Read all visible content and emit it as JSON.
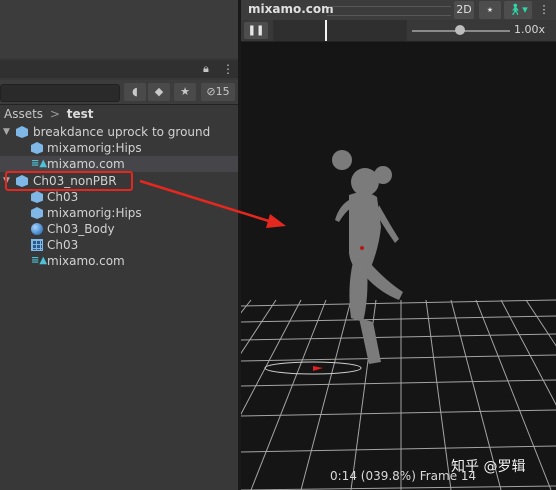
{
  "project": {
    "hidden_count": "15",
    "breadcrumb": {
      "root": "Assets",
      "separator": ">",
      "current": "test"
    }
  },
  "tree": [
    {
      "label": "breakdance uprock to ground",
      "type": "model",
      "expanded": true
    },
    {
      "label": "mixamorig:Hips",
      "type": "model",
      "expanded": false
    },
    {
      "label": "mixamo.com",
      "type": "animation",
      "expanded": false
    },
    {
      "label": "Ch03_nonPBR",
      "type": "model",
      "expanded": true
    },
    {
      "label": "Ch03",
      "type": "model",
      "expanded": false
    },
    {
      "label": "mixamorig:Hips",
      "type": "model",
      "expanded": false
    },
    {
      "label": "Ch03_Body",
      "type": "material",
      "expanded": false
    },
    {
      "label": "Ch03",
      "type": "mesh",
      "expanded": false
    },
    {
      "label": "mixamo.com",
      "type": "animation",
      "expanded": false
    }
  ],
  "preview": {
    "title": "mixamo.com",
    "btn_2d": "2D",
    "speed": "1.00x",
    "playhead_fraction": 0.39,
    "status": "0:14 (039.8%) Frame 14"
  },
  "watermark": "知乎 @罗辑",
  "colors": {
    "annotation_red": "#e4281f"
  }
}
